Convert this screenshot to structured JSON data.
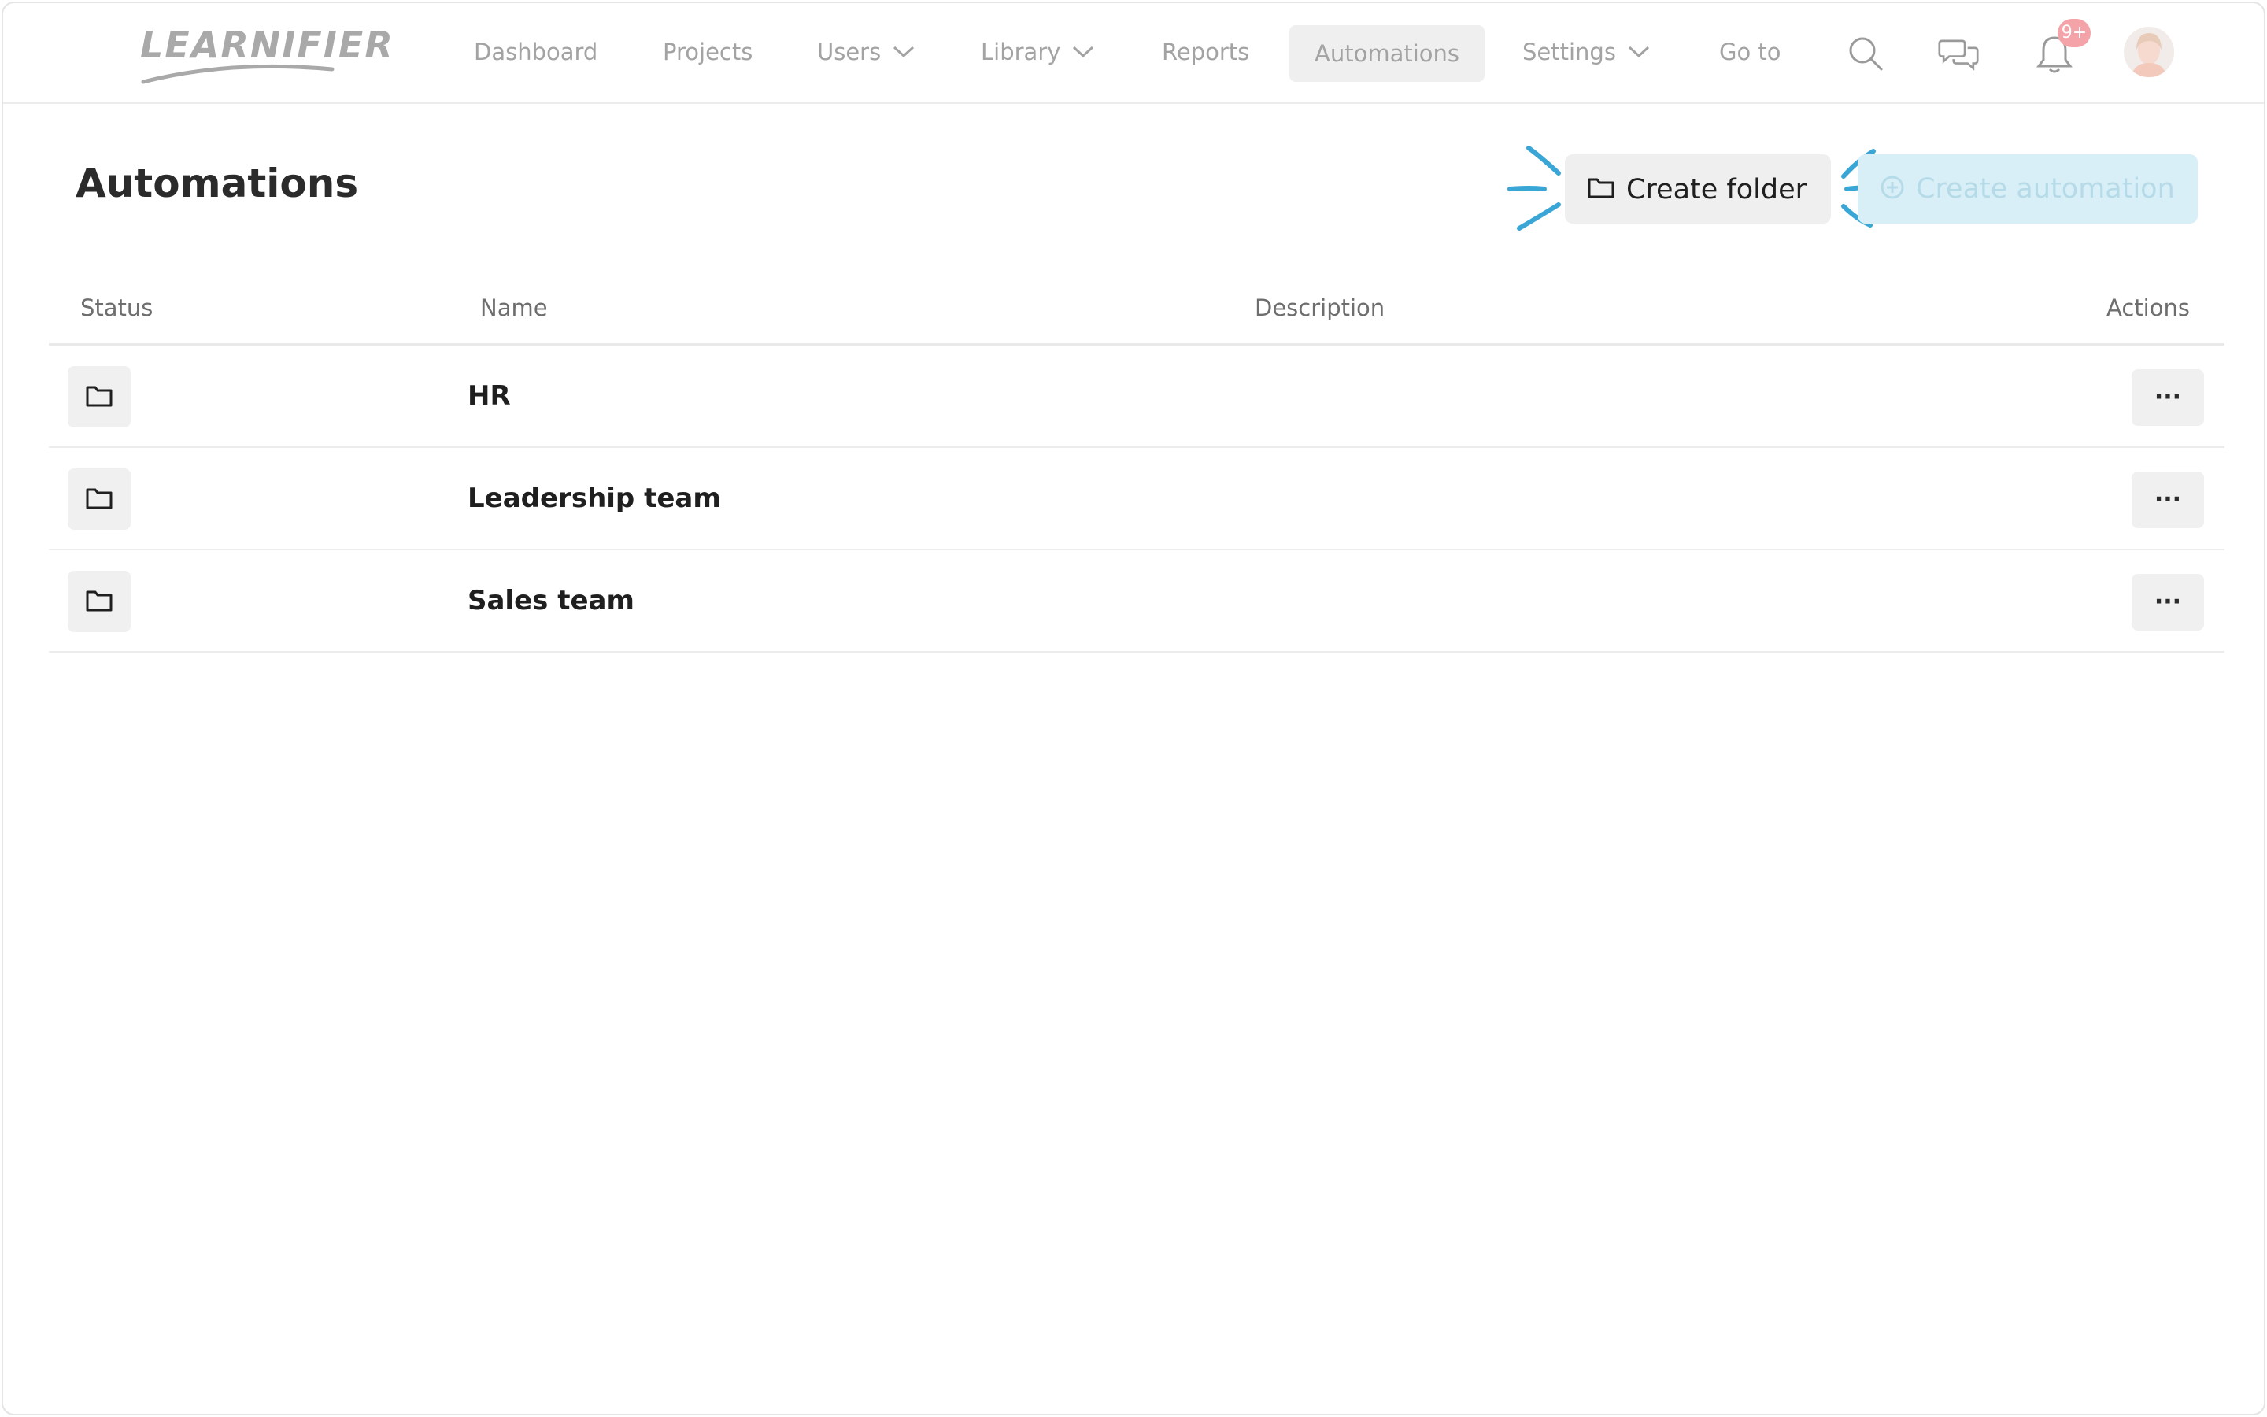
{
  "app": {
    "logo_text": "LEARNIFIER"
  },
  "nav": {
    "items": [
      {
        "label": "Dashboard",
        "dropdown": false
      },
      {
        "label": "Projects",
        "dropdown": false
      },
      {
        "label": "Users",
        "dropdown": true
      },
      {
        "label": "Library",
        "dropdown": true
      },
      {
        "label": "Reports",
        "dropdown": false
      },
      {
        "label": "Automations",
        "dropdown": false,
        "active": true
      },
      {
        "label": "Settings",
        "dropdown": true
      },
      {
        "label": "Go to",
        "dropdown": false
      }
    ],
    "icons": [
      "search-icon",
      "chat-icon",
      "bell-icon",
      "avatar"
    ],
    "notification_badge": "9+"
  },
  "page": {
    "title": "Automations",
    "create_folder_label": "Create folder",
    "create_automation_label": "Create automation"
  },
  "table": {
    "columns": [
      "Status",
      "Name",
      "Description",
      "Actions"
    ],
    "rows": [
      {
        "status_icon": "folder-icon",
        "name": "HR",
        "description": "",
        "actions_label": "···"
      },
      {
        "status_icon": "folder-icon",
        "name": "Leadership team",
        "description": "",
        "actions_label": "···"
      },
      {
        "status_icon": "folder-icon",
        "name": "Sales team",
        "description": "",
        "actions_label": "···"
      }
    ]
  },
  "colors": {
    "accent": "#3aa6d6",
    "accent_light": "#d9eff7",
    "badge": "#f4a3a9",
    "nav_text": "#a3a3a3"
  }
}
